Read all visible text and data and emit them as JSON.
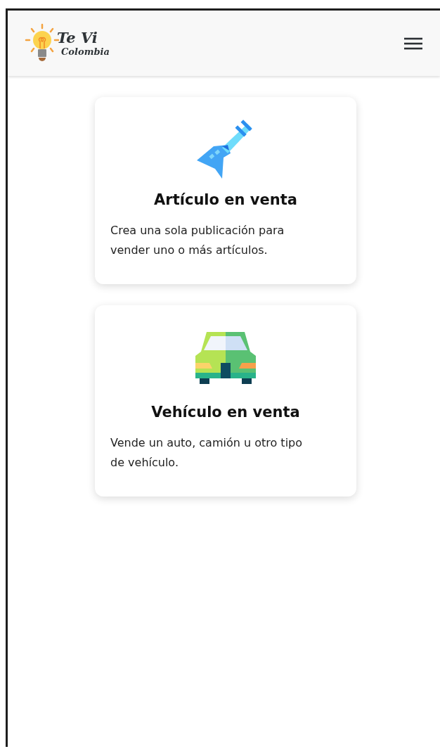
{
  "header": {
    "logo": {
      "line_1": "Te Vi",
      "line_2": "Colombia"
    }
  },
  "cards": [
    {
      "kind": "guitar",
      "title": "Artículo en venta",
      "description": "Crea una sola publicación para vender uno o más artículos."
    },
    {
      "kind": "car",
      "title": "Vehículo en venta",
      "description": "Vende un auto, camión u otro tipo de vehículo."
    }
  ]
}
